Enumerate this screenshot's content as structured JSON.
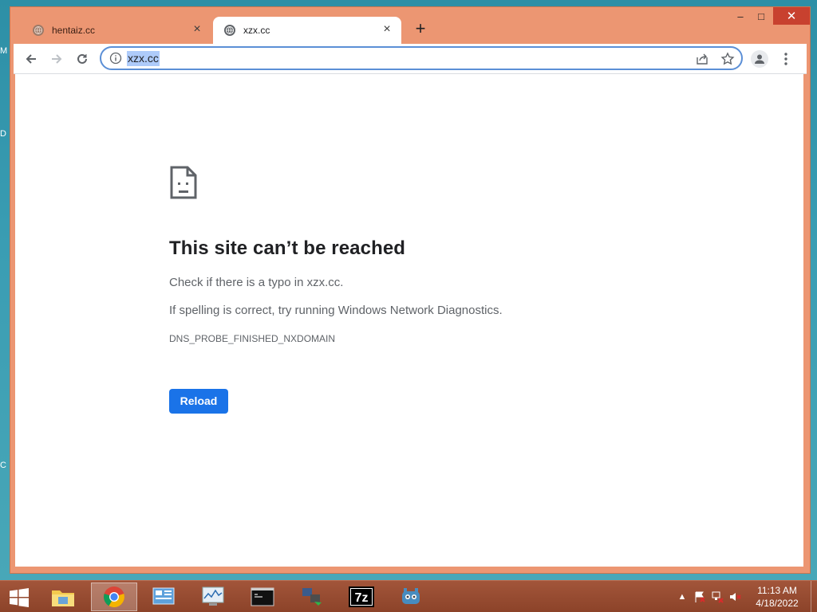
{
  "desktop": {
    "edge_glyphs": [
      "M",
      "D",
      "C"
    ]
  },
  "window": {
    "tabs": [
      {
        "title": "hentaiz.cc",
        "active": false
      },
      {
        "title": "xzx.cc",
        "active": true
      }
    ],
    "new_tab_label": "+",
    "controls": {
      "minimize": "–",
      "maximize": "□",
      "close": "✕"
    }
  },
  "toolbar": {
    "address": "xzx.cc",
    "icons": [
      "back-icon",
      "forward-icon",
      "reload-icon",
      "info-icon",
      "share-icon",
      "star-icon",
      "profile-icon",
      "menu-icon"
    ]
  },
  "error_page": {
    "title": "This site can’t be reached",
    "line1": "Check if there is a typo in xzx.cc.",
    "line2_prefix": "If spelling is correct, ",
    "line2_link": "try running Windows Network Diagnostics",
    "line2_suffix": ".",
    "error_code": "DNS_PROBE_FINISHED_NXDOMAIN",
    "reload_label": "Reload"
  },
  "taskbar": {
    "apps": [
      "file-explorer",
      "chrome",
      "control-panel",
      "performance-monitor",
      "command-prompt",
      "network-tool",
      "7zip",
      "godot"
    ],
    "clock_time": "11:13 AM",
    "clock_date": "4/18/2022"
  },
  "colors": {
    "window_frame": "#ec9672",
    "link": "#3367d6",
    "button": "#1a73e8",
    "taskbar": "#8c4329"
  }
}
